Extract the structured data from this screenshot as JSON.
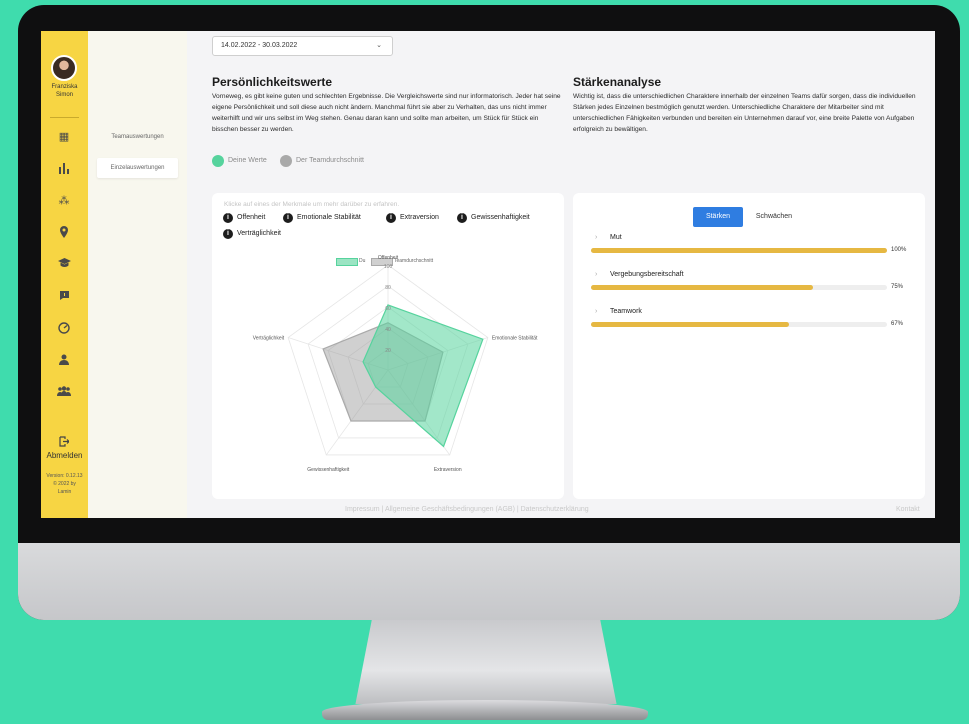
{
  "user": {
    "name_line1": "Franziska",
    "name_line2": "Simon"
  },
  "sidebar": {
    "icons": [
      "dashboard-icon",
      "bar-chart-icon",
      "people-pin-icon",
      "location-pin-icon",
      "graduation-cap-icon",
      "chat-icon",
      "gauge-icon",
      "user-icon",
      "team-icon"
    ],
    "logout_label": "Abmelden",
    "version_line1": "Version: 0.12.13",
    "version_line2": "© 2022 by",
    "version_line3": "Lamin"
  },
  "subnav": {
    "items": [
      "Teamauswertungen",
      "Einzelauswertungen"
    ],
    "active": "Einzelauswertungen"
  },
  "date_range": "14.02.2022 - 30.03.2022",
  "personality": {
    "title": "Persönlichkeitswerte",
    "text": "Vorneweg, es gibt keine guten und schlechten Ergebnisse. Die Vergleichswerte sind nur informatorisch. Jeder hat seine eigene Persönlichkeit und soll diese auch nicht ändern. Manchmal führt sie aber zu Verhalten, das uns nicht immer weiterhilft und wir uns selbst im Weg stehen. Genau daran kann und sollte man arbeiten, um Stück für Stück ein bisschen besser zu werden.",
    "legend_own": "Deine Werte",
    "legend_team": "Der Teamdurchschnitt"
  },
  "strengths_analysis": {
    "title": "Stärkenanalyse",
    "text": "Wichtig ist, dass die unterschiedlichen Charaktere innerhalb der einzelnen Teams dafür sorgen, dass die individuellen Stärken jedes Einzelnen bestmöglich genutzt werden. Unterschiedliche Charaktere der Mitarbeiter sind mit unterschiedlichen Fähigkeiten verbunden und bereiten ein Unternehmen darauf vor, eine breite Palette von Aufgaben erfolgreich zu bewältigen."
  },
  "radar_card": {
    "hint": "Klicke auf eines der Merkmale um mehr darüber zu erfahren.",
    "traits": [
      "Offenheit",
      "Emotionale Stabilität",
      "Extraversion",
      "Gewissenhaftigkeit",
      "Verträglichkeit"
    ]
  },
  "chart_data": {
    "type": "radar",
    "axes": [
      "Offenheit",
      "Emotionale Stabilität",
      "Extraversion",
      "Gewissenhaftigkeit",
      "Verträglichkeit"
    ],
    "tick_labels": [
      "20",
      "40",
      "60",
      "80",
      "100"
    ],
    "rlim": [
      0,
      100
    ],
    "series": [
      {
        "name": "Du",
        "values": [
          62,
          95,
          90,
          20,
          25
        ],
        "color": "#56d39d"
      },
      {
        "name": "Teamdurchschnitt",
        "values": [
          45,
          55,
          60,
          60,
          65
        ],
        "color": "#aaaaaa"
      }
    ]
  },
  "strengths_card": {
    "tab_active": "Stärken",
    "tab_inactive": "Schwächen",
    "items": [
      {
        "label": "Mut",
        "percent_label": "100%",
        "value": 100
      },
      {
        "label": "Vergebungsbereitschaft",
        "percent_label": "75%",
        "value": 75
      },
      {
        "label": "Teamwork",
        "percent_label": "67%",
        "value": 67
      }
    ],
    "accent": "#e6b842"
  },
  "footer": {
    "links": "Impressum | Allgemeine Geschäftsbedingungen (AGB) | Datenschutzerklärung",
    "contact": "Kontakt"
  }
}
